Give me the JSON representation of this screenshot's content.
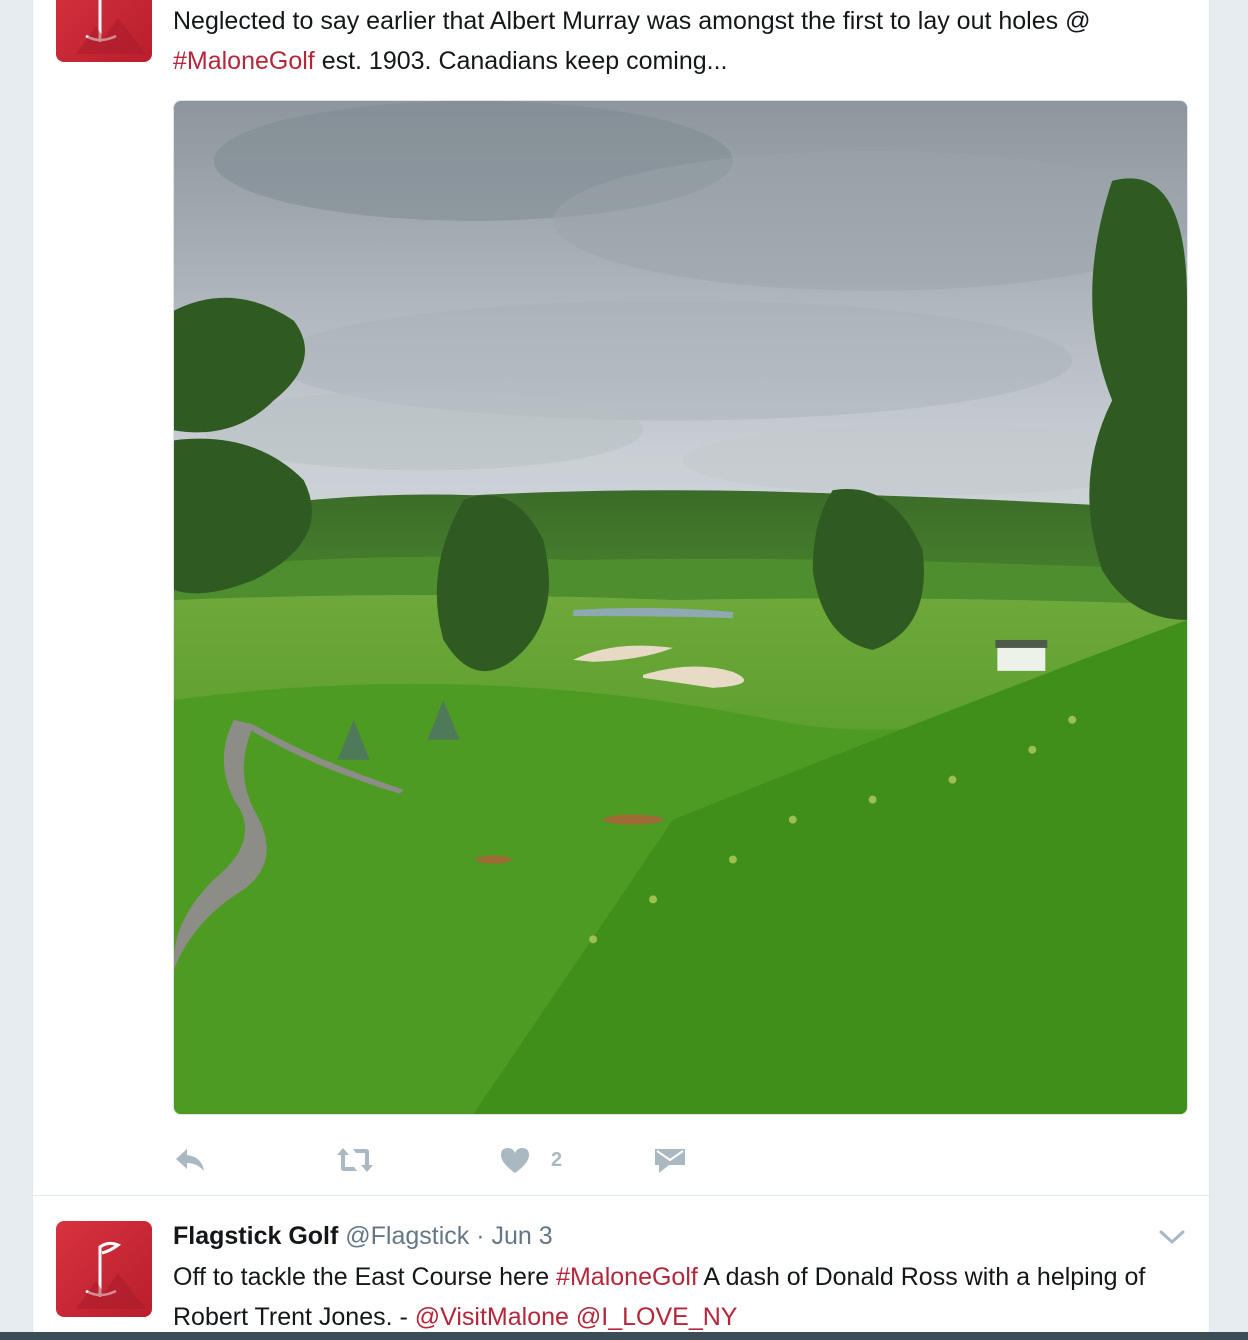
{
  "tweet1": {
    "text_part1": "Neglected to say earlier that Albert Murray was amongst the first to lay out holes @ ",
    "hashtag": "#MaloneGolf",
    "text_part2": " est. 1903. Canadians keep coming...",
    "likes": "2",
    "media_alt": "Golf course landscape with green hills, sand bunkers, winding cart path, pine trees and cloudy sky"
  },
  "tweet2": {
    "name": "Flagstick Golf",
    "handle": "@Flagstick",
    "separator": " · ",
    "date": "Jun 3",
    "text_part1": "Off to tackle the East Course here ",
    "hashtag": "#MaloneGolf",
    "text_part2": " A dash of Donald Ross with a helping of Robert Trent Jones. - ",
    "mention1": "@VisitMalone",
    "mention2": "@I_LOVE_NY"
  },
  "icons": {
    "reply": "reply-icon",
    "retweet": "retweet-icon",
    "like": "heart-icon",
    "dm": "envelope-icon",
    "caret": "chevron-down-icon"
  },
  "colors": {
    "link": "#b4263a",
    "avatar": "#d8323f",
    "action": "#aab8c2",
    "meta": "#657786"
  }
}
